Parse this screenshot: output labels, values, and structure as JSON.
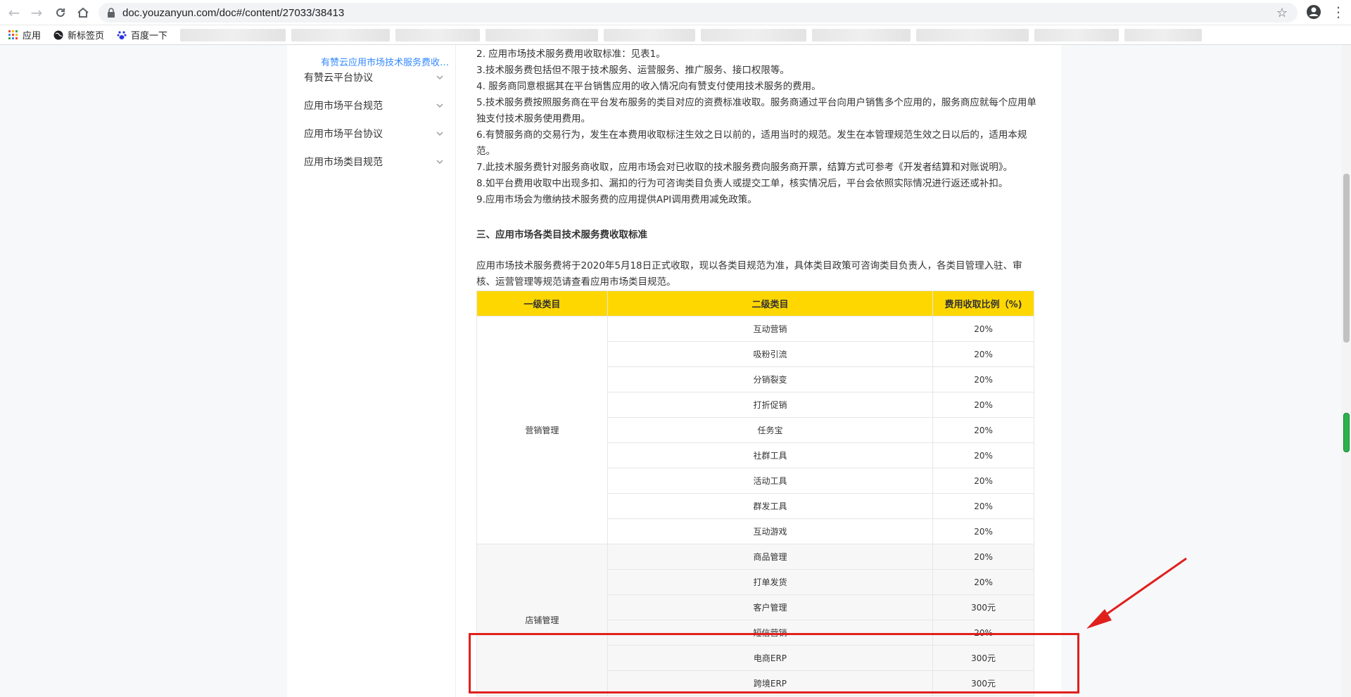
{
  "browser": {
    "url": "doc.youzanyun.com/doc#/content/27033/38413",
    "bookmarks": [
      {
        "label": "应用"
      },
      {
        "label": "新标签页"
      },
      {
        "label": "百度一下"
      }
    ]
  },
  "sidebar": {
    "active_item": "有赞云应用市场技术服务费收取标准",
    "items": [
      {
        "label": "有赞云平台协议"
      },
      {
        "label": "应用市场平台规范"
      },
      {
        "label": "应用市场平台协议"
      },
      {
        "label": "应用市场类目规范"
      }
    ]
  },
  "doc": {
    "paragraphs": [
      "2. 应用市场技术服务费用收取标准：见表1。",
      "3.技术服务费包括但不限于技术服务、运营服务、推广服务、接口权限等。",
      "4. 服务商同意根据其在平台销售应用的收入情况向有赞支付使用技术服务的费用。",
      "5.技术服务费按照服务商在平台发布服务的类目对应的资费标准收取。服务商通过平台向用户销售多个应用的，服务商应就每个应用单独支付技术服务使用费用。",
      "6.有赞服务商的交易行为，发生在本费用收取标注生效之日以前的，适用当时的规范。发生在本管理规范生效之日以后的，适用本规范。",
      "7.此技术服务费针对服务商收取，应用市场会对已收取的技术服务费向服务商开票，结算方式可参考《开发者结算和对账说明》。",
      "8.如平台费用收取中出现多扣、漏扣的行为可咨询类目负责人或提交工单，核实情况后，平台会依照实际情况进行返还或补扣。",
      "9.应用市场会为缴纳技术服务费的应用提供API调用费用减免政策。"
    ],
    "section_heading": "三、应用市场各类目技术服务费收取标准",
    "intro": "应用市场技术服务费将于2020年5月18日正式收取，现以各类目规范为准，具体类目政策可咨询类目负责人，各类目管理入驻、审核、运营管理等规范请查看应用市场类目规范。"
  },
  "table": {
    "headers": [
      "一级类目",
      "二级类目",
      "费用收取比例（%)"
    ],
    "groups": [
      {
        "name": "营销管理",
        "rows": [
          [
            "互动营销",
            "20%"
          ],
          [
            "吸粉引流",
            "20%"
          ],
          [
            "分销裂变",
            "20%"
          ],
          [
            "打折促销",
            "20%"
          ],
          [
            "任务宝",
            "20%"
          ],
          [
            "社群工具",
            "20%"
          ],
          [
            "活动工具",
            "20%"
          ],
          [
            "群发工具",
            "20%"
          ],
          [
            "互动游戏",
            "20%"
          ]
        ]
      },
      {
        "name": "店铺管理",
        "rows": [
          [
            "商品管理",
            "20%"
          ],
          [
            "打单发货",
            "20%"
          ],
          [
            "客户管理",
            "300元"
          ],
          [
            "短信营销",
            "20%"
          ],
          [
            "电商ERP",
            "300元"
          ],
          [
            "跨境ERP",
            "300元"
          ]
        ]
      }
    ]
  },
  "colors": {
    "accent": "#3388ff",
    "table_header": "#ffd700",
    "annotation": "#e0201d"
  }
}
